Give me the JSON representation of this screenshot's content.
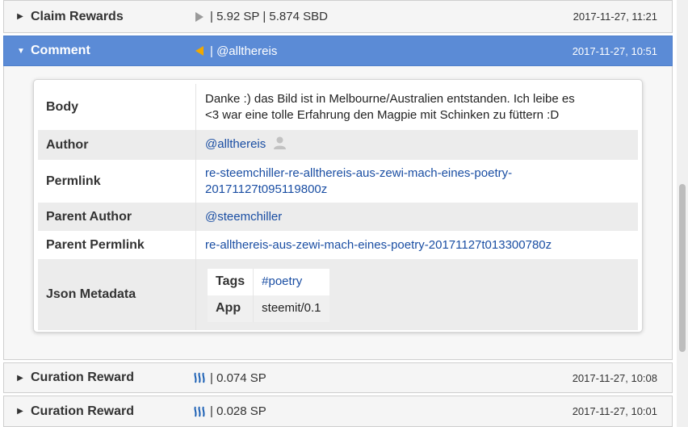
{
  "rows": [
    {
      "title": "Claim Rewards",
      "icon": "grey-triangle-icon",
      "summary": "| 5.92 SP | 5.874 SBD",
      "timestamp": "2017-11-27, 11:21"
    },
    {
      "title": "Comment",
      "icon": "orange-triangle-left-icon",
      "summary": "| @allthereis",
      "timestamp": "2017-11-27, 10:51"
    },
    {
      "title": "Curation Reward",
      "icon": "steem-icon",
      "summary": "| 0.074 SP",
      "timestamp": "2017-11-27, 10:08"
    },
    {
      "title": "Curation Reward",
      "icon": "steem-icon",
      "summary": "| 0.028 SP",
      "timestamp": "2017-11-27, 10:01"
    }
  ],
  "details": {
    "body_label": "Body",
    "body_line1": "Danke :) das Bild ist in Melbourne/Australien entstanden. Ich leibe es",
    "body_line2": "<3 war eine tolle Erfahrung den Magpie mit Schinken zu füttern :D",
    "author_label": "Author",
    "author": "@allthereis",
    "permlink_label": "Permlink",
    "permlink_line1": "re-steemchiller-re-allthereis-aus-zewi-mach-eines-poetry-",
    "permlink_line2": "20171127t095119800z",
    "parent_author_label": "Parent Author",
    "parent_author": "@steemchiller",
    "parent_permlink_label": "Parent Permlink",
    "parent_permlink": "re-allthereis-aus-zewi-mach-eines-poetry-20171127t013300780z",
    "json_metadata_label": "Json Metadata",
    "meta_tags_label": "Tags",
    "meta_tags": "#poetry",
    "meta_app_label": "App",
    "meta_app": "steemit/0.1"
  },
  "colors": {
    "accent": "#5b8bd6",
    "link": "#1a4ea3",
    "orange": "#f0a800",
    "steem_blue": "#1a5fb4"
  }
}
